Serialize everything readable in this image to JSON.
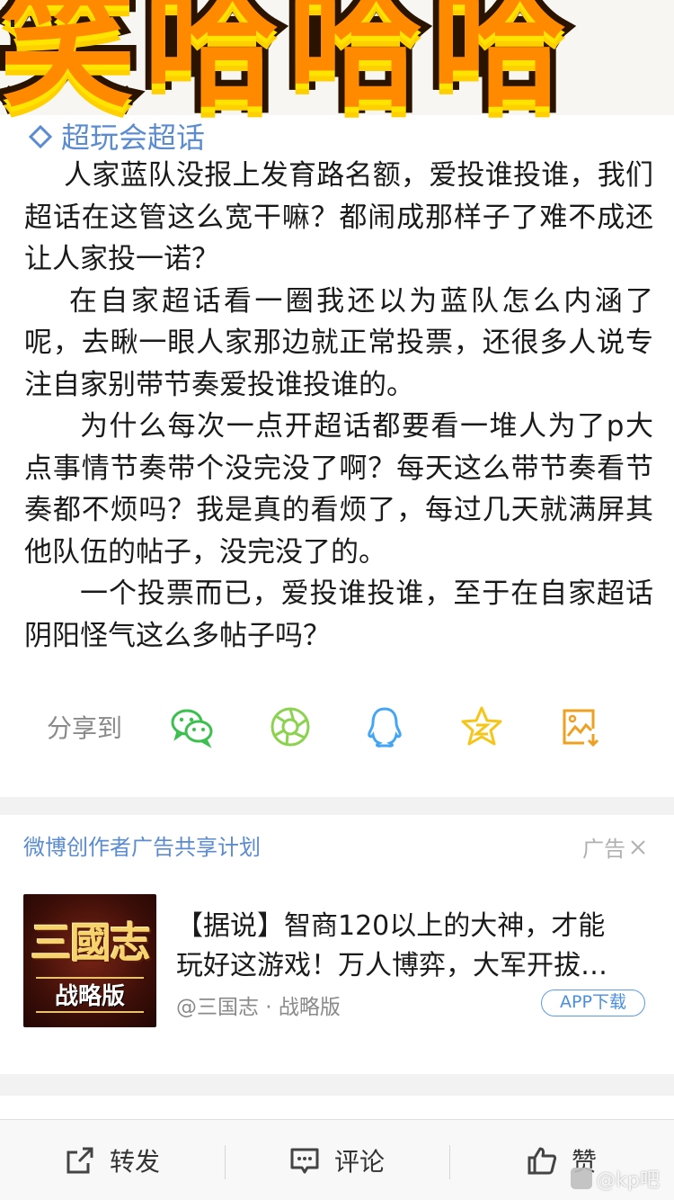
{
  "banner": {
    "sticker_text": "笑哈哈哈"
  },
  "topic": {
    "label": "超玩会超话",
    "icon": "topic-link-icon"
  },
  "post": {
    "paragraphs": [
      "人家蓝队没报上发育路名额，爱投谁投谁，我们超话在这管这么宽干嘛？都闹成那样子了难不成还让人家投一诺？",
      "在自家超话看一圈我还以为蓝队怎么内涵了呢，去瞅一眼人家那边就正常投票，还很多人说专注自家别带节奏爱投谁投谁的。",
      "为什么每次一点开超话都要看一堆人为了p大点事情节奏带个没完没了啊？每天这么带节奏看节奏都不烦吗？我是真的看烦了，每过几天就满屏其他队伍的帖子，没完没了的。",
      "一个投票而已，爱投谁投谁，至于在自家超话阴阳怪气这么多帖子吗？"
    ]
  },
  "share": {
    "label": "分享到",
    "targets": [
      "wechat-icon",
      "moments-icon",
      "qq-icon",
      "qzone-icon",
      "save-image-icon"
    ]
  },
  "ad": {
    "header": "微博创作者广告共享计划",
    "tag": "广告",
    "thumb_title": "三國志",
    "thumb_subtitle": "战略版",
    "title_line1": "【据说】智商120以上的大神，才能",
    "title_line2": "玩好这游戏！万人博弈，大军开拔…",
    "source": "@三国志 · 战略版",
    "cta": "APP下载"
  },
  "toolbar": {
    "repost": "转发",
    "comment": "评论",
    "like": "赞"
  },
  "watermark": "@kp吧",
  "colors": {
    "link": "#5b8bd1",
    "sticker_fill": "#ff8a00",
    "sticker_outline": "#2a1400",
    "wechat": "#3bbf4e",
    "moments": "#8bd34f",
    "qq": "#42a5f5",
    "qzone": "#f5c518",
    "save": "#f0a020"
  }
}
